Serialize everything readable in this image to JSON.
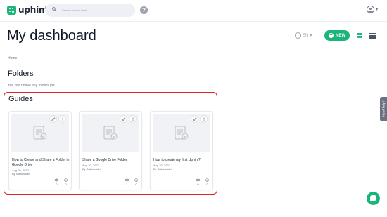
{
  "app": {
    "logo_text": "uphint"
  },
  "search": {
    "placeholder": "Search for text here..."
  },
  "help": {
    "label": "?"
  },
  "header": {
    "title": "My dashboard",
    "language": "EN",
    "new_button": "NEW"
  },
  "breadcrumb": {
    "home": "Home"
  },
  "folders": {
    "title": "Folders",
    "empty_text": "You don't have any folders yet"
  },
  "guides": {
    "title": "Guides",
    "items": [
      {
        "title": "How to Create and Share a Folder in Google Drive",
        "date": "Aug 20, 2022",
        "author": "By Salahuddin",
        "views": "0",
        "reactions": "0"
      },
      {
        "title": "Share a Google Drive Folder",
        "date": "Aug 20, 2022",
        "author": "By Salahuddin",
        "views": "1",
        "reactions": "0"
      },
      {
        "title": "How to create my first Uphint?",
        "date": "Aug 20, 2022",
        "author": "By Salahuddin",
        "views": "0",
        "reactions": "0"
      }
    ]
  },
  "side_tab": {
    "label": "Need help?"
  },
  "colors": {
    "brand": "#1bb57a",
    "highlight": "#e02424"
  }
}
